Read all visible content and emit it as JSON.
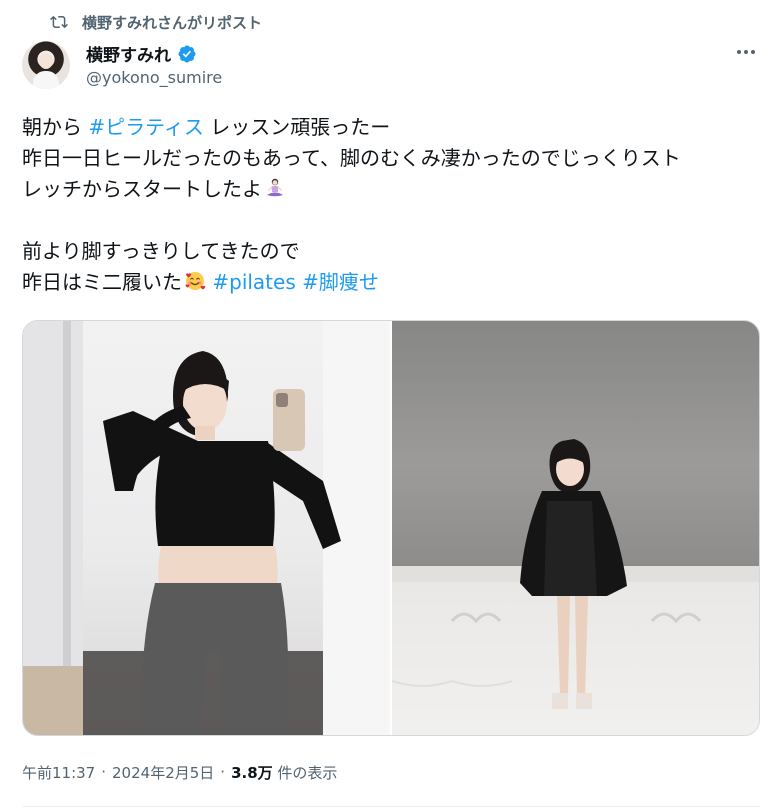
{
  "repost": {
    "label": "横野すみれさんがリポスト",
    "icon": "repost-icon"
  },
  "author": {
    "name": "横野すみれ",
    "handle": "@yokono_sumire",
    "verified_icon": "verified-badge-icon",
    "verified_color": "#1d9bf0"
  },
  "tweet": {
    "line1_a": "朝から ",
    "line1_tag": "#ピラティス",
    "line1_b": " レッスン頑張ったー",
    "line2": "昨日一日ヒールだったのもあって、脚のむくみ凄かったのでじっくりスト",
    "line3": "レッチからスタートしたよ",
    "line3_emoji": "person-in-lotus-position-emoji",
    "line5": "前より脚すっきりしてきたので",
    "line6_a": "昨日はミ二履いた",
    "line6_emoji": "smiling-face-with-hearts-emoji",
    "line6_tag1": "#pilates",
    "line6_tag2": "#脚痩せ"
  },
  "media": [
    {
      "name": "mirror-selfie-photo"
    },
    {
      "name": "seated-outfit-photo"
    }
  ],
  "footer": {
    "time": "午前11:37",
    "sep1": "·",
    "date": "2024年2月5日",
    "sep2": "·",
    "views_count": "3.8万",
    "views_label": "件の表示"
  },
  "colors": {
    "link": "#1d9bf0",
    "secondary_text": "#536471",
    "primary_text": "#0f1419"
  }
}
